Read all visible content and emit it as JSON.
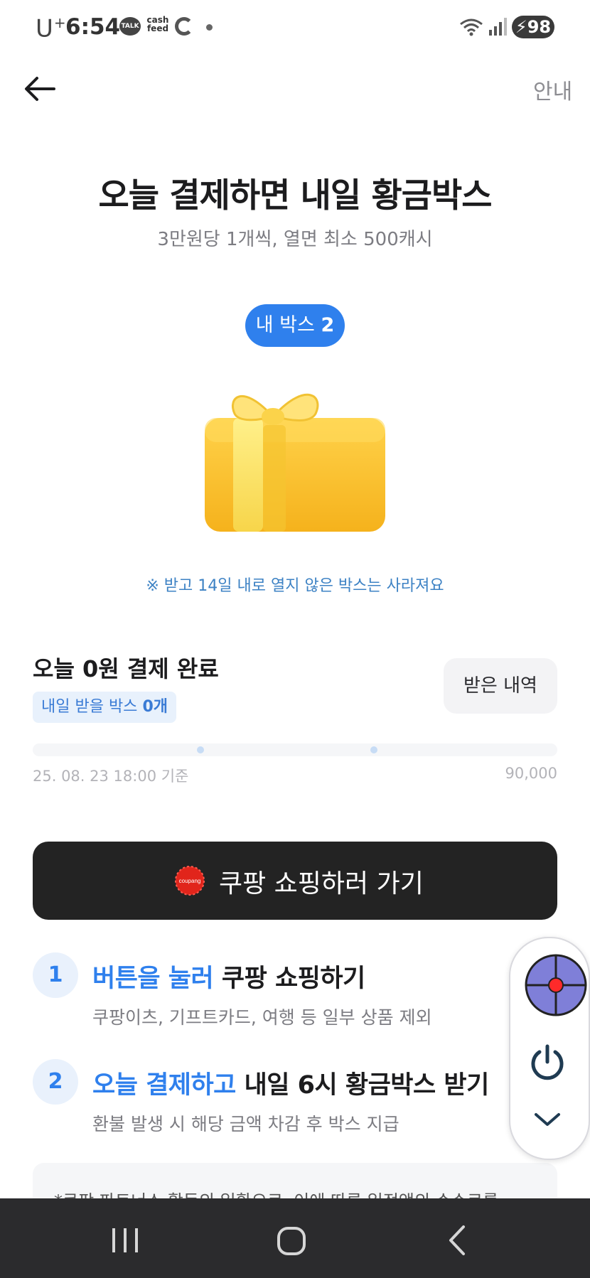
{
  "status_bar": {
    "carrier": "U",
    "carrier_plus": "+",
    "time": "6:54",
    "talk_label": "TALK",
    "cashfeed_label": "cash feed",
    "battery": "98"
  },
  "header": {
    "info_label": "안내"
  },
  "hero": {
    "title": "오늘 결제하면 내일 황금박스",
    "subtitle": "3만원당 1개씩, 열면 최소 500캐시",
    "my_box_label": "내 박스",
    "my_box_count": "2",
    "notice": "※ 받고 14일 내로 열지 않은 박스는 사라져요"
  },
  "today": {
    "title": "오늘 0원 결제 완료",
    "tomorrow_label": "내일 받을 박스",
    "tomorrow_count": "0개",
    "history_button": "받은 내역",
    "progress_value": 0,
    "progress_date": "25. 08. 23 18:00 기준",
    "progress_max": "90,000"
  },
  "cta": {
    "logo_text": "coupang",
    "label": "쿠팡 쇼핑하러 가기"
  },
  "steps": [
    {
      "number": "1",
      "highlight": "버튼을 눌러",
      "rest": " 쿠팡 쇼핑하기",
      "sub": "쿠팡이츠, 기프트카드, 여행 등 일부 상품 제외"
    },
    {
      "number": "2",
      "highlight": "오늘 결제하고",
      "rest": " 내일 6시 황금박스 받기",
      "sub": "환불 발생 시 해당 금액 차감 후 박스 지급"
    }
  ],
  "fine_print": "*쿠팡 파트너스 활동의 일환으로, 이에 따른 일정액의 수수료를",
  "colors": {
    "accent": "#2f80ed",
    "cta_bg": "#232323",
    "nav_bg": "#2b2b2d"
  }
}
